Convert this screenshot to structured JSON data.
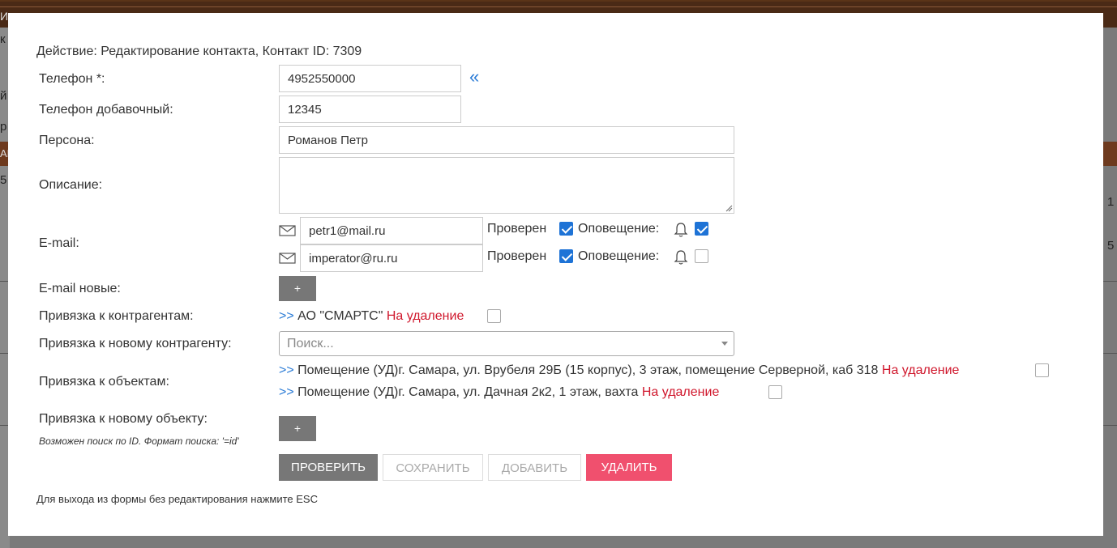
{
  "background": {
    "fragments": [
      "И",
      "к",
      "й",
      "р",
      "АВ",
      "5",
      "1",
      "5"
    ]
  },
  "modal": {
    "action_title": "Действие: Редактирование контакта, Контакт ID: 7309",
    "labels": {
      "phone": "Телефон *:",
      "phone_ext": "Телефон добавочный:",
      "person": "Персона:",
      "description": "Описание:",
      "email": "E-mail:",
      "email_new": "E-mail новые:",
      "contractors": "Привязка к контрагентам:",
      "new_contractor": "Привязка к новому контрагенту:",
      "objects": "Привязка к объектам:",
      "new_object": "Привязка к новому объекту:"
    },
    "fields": {
      "phone": "4952550000",
      "phone_ext": "12345",
      "person": "Романов Петр",
      "description": ""
    },
    "phone_link": "«",
    "emails": [
      {
        "address": "petr1@mail.ru",
        "verified_label": "Проверен",
        "verified": true,
        "notify_label": "Оповещение:",
        "notify": true
      },
      {
        "address": "imperator@ru.ru",
        "verified_label": "Проверен",
        "verified": true,
        "notify_label": "Оповещение:",
        "notify": false
      }
    ],
    "plus_label": "+",
    "contractor": {
      "prefix": ">>",
      "name": "АО \"СМАРТС\"",
      "delete_label": "На удаление",
      "delete_checked": false
    },
    "contractor_search_placeholder": "Поиск...",
    "objects": [
      {
        "prefix": ">>",
        "name": "Помещение (УД)г. Самара, ул. Врубеля 29Б (15 корпус), 3 этаж, помещение Серверной, каб 318",
        "delete_label": "На удаление",
        "delete_checked": false
      },
      {
        "prefix": ">>",
        "name": "Помещение (УД)г. Самара, ул. Дачная 2к2, 1 этаж, вахта",
        "delete_label": "На удаление",
        "delete_checked": false
      }
    ],
    "object_hint": "Возможен поиск по ID. Формат поиска: '=id'",
    "buttons": {
      "check": "ПРОВЕРИТЬ",
      "save": "СОХРАНИТЬ",
      "add": "ДОБАВИТЬ",
      "delete": "УДАЛИТЬ"
    },
    "footer_note": "Для выхода из формы без редактирования нажмите ESC"
  },
  "colors": {
    "accent_blue": "#1e73d6",
    "delete_red": "#d0182d",
    "delete_button": "#f0506e",
    "primary_button": "#777777"
  }
}
